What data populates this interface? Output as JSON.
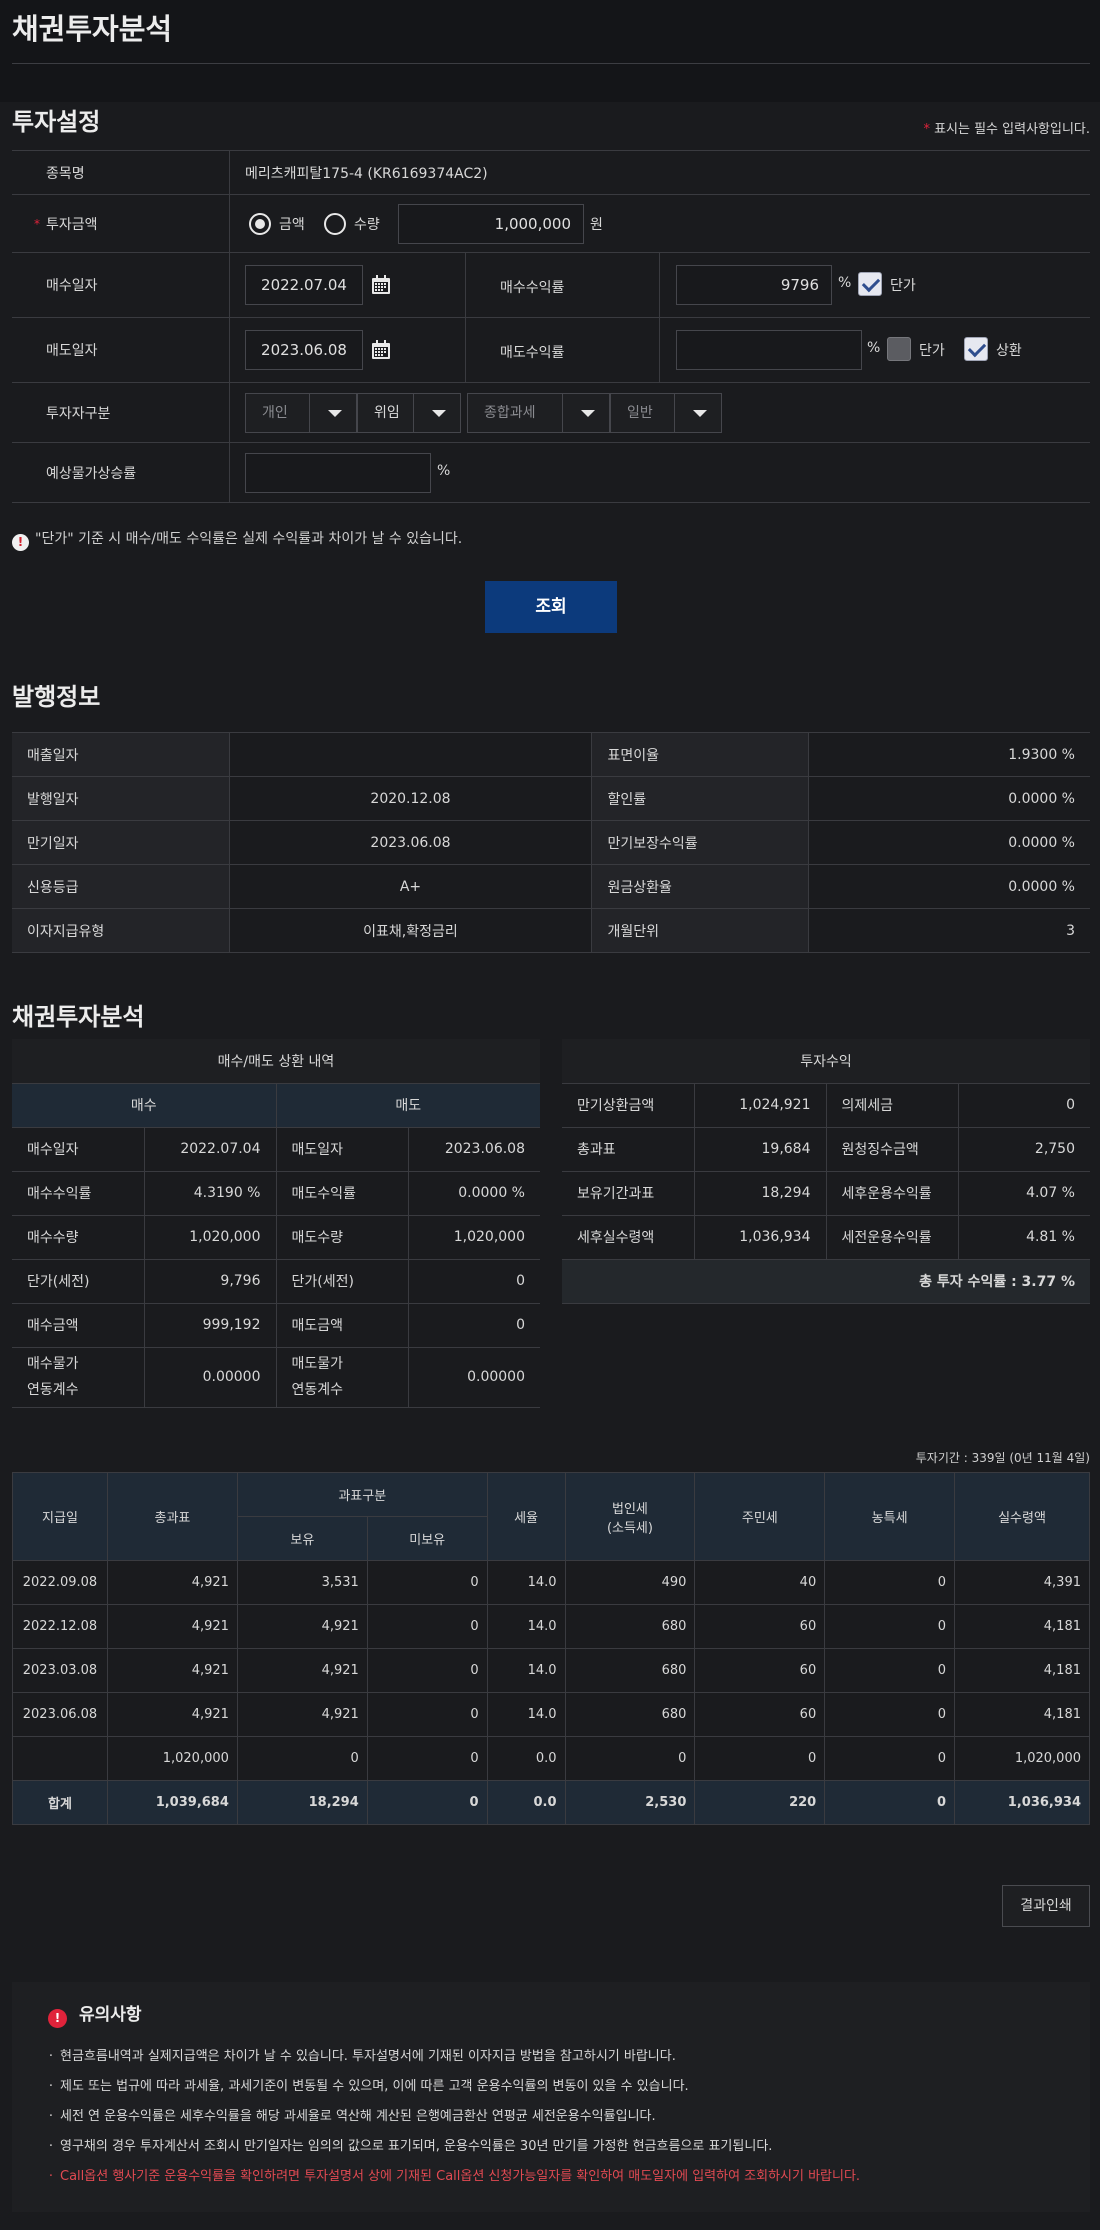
{
  "page_title": "채권투자분석",
  "settings": {
    "title": "투자설정",
    "required_note": "표시는 필수 입력사항입니다.",
    "rows": {
      "bond_name_label": "종목명",
      "bond_name_value": "메리츠캐피탈175-4 (KR6169374AC2)",
      "amount_label": "투자금액",
      "amount_radio_1": "금액",
      "amount_radio_2": "수량",
      "amount_value": "1,000,000",
      "amount_unit": "원",
      "buy_date_label": "매수일자",
      "buy_date_value": "2022.07.04",
      "buy_yield_label": "매수수익률",
      "buy_yield_value": "9796",
      "buy_yield_unit": "%",
      "buy_price_check_label": "단가",
      "sell_date_label": "매도일자",
      "sell_date_value": "2023.06.08",
      "sell_yield_label": "매도수익률",
      "sell_yield_value": "",
      "sell_yield_unit": "%",
      "sell_price_check_label": "단가",
      "redeem_check_label": "상환",
      "investor_label": "투자자구분",
      "investor_opts": [
        "개인",
        "위임",
        "종합과세",
        "일반"
      ],
      "inflation_label": "예상물가상승률",
      "inflation_value": "",
      "inflation_unit": "%"
    },
    "warning": "\"단가\" 기준 시 매수/매도 수익률은 실제 수익률과 차이가 날 수 있습니다.",
    "search_button": "조회"
  },
  "issue": {
    "title": "발행정보",
    "rows": [
      [
        "매출일자",
        "",
        "표면이율",
        "1.9300 %"
      ],
      [
        "발행일자",
        "2020.12.08",
        "할인률",
        "0.0000 %"
      ],
      [
        "만기일자",
        "2023.06.08",
        "만기보장수익률",
        "0.0000 %"
      ],
      [
        "신용등급",
        "A+",
        "원금상환율",
        "0.0000 %"
      ],
      [
        "이자지급유형",
        "이표채,확정금리",
        "개월단위",
        "3"
      ]
    ]
  },
  "analysis": {
    "title": "채권투자분석",
    "left_header": "매수/매도 상환 내역",
    "buy_header": "매수",
    "sell_header": "매도",
    "left_rows": [
      [
        "매수일자",
        "2022.07.04",
        "매도일자",
        "2023.06.08"
      ],
      [
        "매수수익률",
        "4.3190 %",
        "매도수익률",
        "0.0000 %"
      ],
      [
        "매수수량",
        "1,020,000",
        "매도수량",
        "1,020,000"
      ],
      [
        "단가(세전)",
        "9,796",
        "단가(세전)",
        "0"
      ],
      [
        "매수금액",
        "999,192",
        "매도금액",
        "0"
      ],
      [
        "매수물가\n연동계수",
        "0.00000",
        "매도물가\n연동계수",
        "0.00000"
      ]
    ],
    "right_header": "투자수익",
    "right_rows": [
      [
        "만기상환금액",
        "1,024,921",
        "의제세금",
        "0"
      ],
      [
        "총과표",
        "19,684",
        "원청징수금액",
        "2,750"
      ],
      [
        "보유기간과표",
        "18,294",
        "세후운용수익률",
        "4.07 %"
      ],
      [
        "세후실수령액",
        "1,036,934",
        "세전운용수익률",
        "4.81 %"
      ]
    ],
    "total_yield": "총 투자 수익률 : 3.77 %"
  },
  "cashflow": {
    "period": "투자기간 : 339일 (0년 11월 4일)",
    "headers": {
      "date": "지급일",
      "total": "총과표",
      "tax_group": "과표구분",
      "own": "보유",
      "not_own": "미보유",
      "rate": "세율",
      "corp_tax": "법인세",
      "corp_tax_sub": "(소득세)",
      "resident": "주민세",
      "farm": "농특세",
      "net": "실수령액"
    },
    "rows": [
      [
        "2022.09.08",
        "4,921",
        "3,531",
        "0",
        "14.0",
        "490",
        "40",
        "0",
        "4,391"
      ],
      [
        "2022.12.08",
        "4,921",
        "4,921",
        "0",
        "14.0",
        "680",
        "60",
        "0",
        "4,181"
      ],
      [
        "2023.03.08",
        "4,921",
        "4,921",
        "0",
        "14.0",
        "680",
        "60",
        "0",
        "4,181"
      ],
      [
        "2023.06.08",
        "4,921",
        "4,921",
        "0",
        "14.0",
        "680",
        "60",
        "0",
        "4,181"
      ],
      [
        "",
        "1,020,000",
        "0",
        "0",
        "0.0",
        "0",
        "0",
        "0",
        "1,020,000"
      ]
    ],
    "sum": [
      "합계",
      "1,039,684",
      "18,294",
      "0",
      "0.0",
      "2,530",
      "220",
      "0",
      "1,036,934"
    ]
  },
  "print_button": "결과인쇄",
  "notice": {
    "title": "유의사항",
    "items": [
      "현금흐름내역과 실제지급액은 차이가 날 수 있습니다. 투자설명서에 기재된 이자지급 방법을 참고하시기 바랍니다.",
      "제도 또는 법규에 따라 과세율, 과세기준이 변동될 수 있으며, 이에 따른 고객 운용수익률의 변동이 있을 수 있습니다.",
      "세전 연 운용수익률은 세후수익률을 해당 과세율로 역산해 계산된 은행예금환산 연평균 세전운용수익률입니다.",
      "영구채의 경우 투자계산서 조회시 만기일자는 임의의 값으로 표기되며, 운용수익률은 30년 만기를 가정한 현금흐름으로 표기됩니다.",
      "Call옵션 행사기준 운용수익률을 확인하려면 투자설명서 상에 기재된 Call옵션 신청가능일자를 확인하여 매도일자에 입력하여 조회하시기 바랍니다."
    ]
  },
  "colors": {
    "accent": "#0c3a7c",
    "required": "#e0233b",
    "warning_text": "#e24a52"
  }
}
